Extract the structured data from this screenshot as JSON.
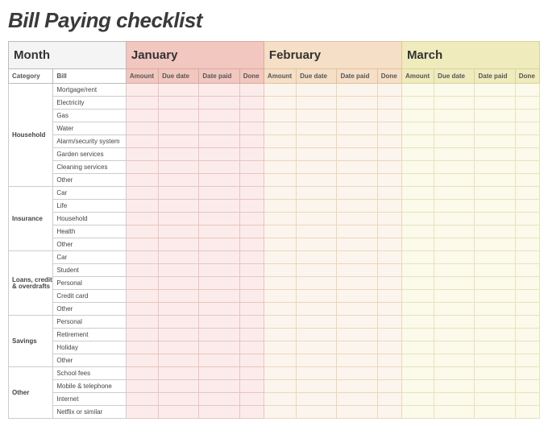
{
  "title": "Bill Paying checklist",
  "month_label": "Month",
  "col_headers": {
    "category": "Category",
    "bill": "Bill"
  },
  "month_cols": [
    "Amount",
    "Due date",
    "Date paid",
    "Done"
  ],
  "months": [
    "January",
    "February",
    "March"
  ],
  "groups": [
    {
      "category": "Household",
      "bills": [
        "Mortgage/rent",
        "Electricity",
        "Gas",
        "Water",
        "Alarm/security system",
        "Garden services",
        "Cleaning services",
        "Other"
      ]
    },
    {
      "category": "Insurance",
      "bills": [
        "Car",
        "Life",
        "Household",
        "Health",
        "Other"
      ]
    },
    {
      "category": "Loans, credit & overdrafts",
      "bills": [
        "Car",
        "Student",
        "Personal",
        "Credit card",
        "Other"
      ]
    },
    {
      "category": "Savings",
      "bills": [
        "Personal",
        "Retirement",
        "Holiday",
        "Other"
      ]
    },
    {
      "category": "Other",
      "bills": [
        "School fees",
        "Mobile & telephone",
        "Internet",
        "Netflix or similar"
      ]
    }
  ]
}
